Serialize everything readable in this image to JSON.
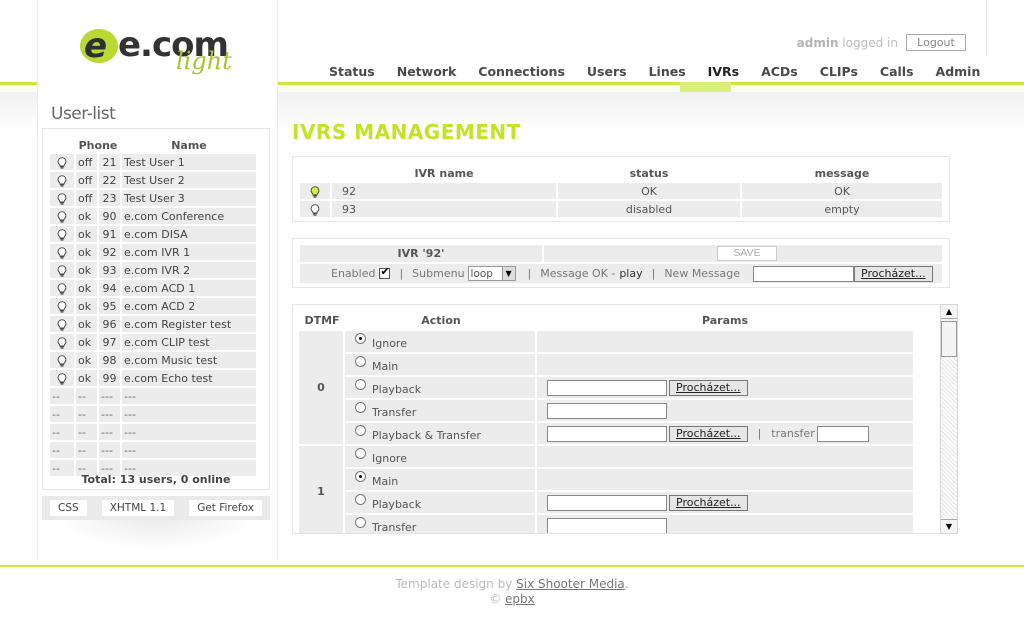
{
  "brand": {
    "logo_main": "e.com",
    "logo_sub": "light"
  },
  "header": {
    "login_user": "admin",
    "login_text": "logged in",
    "logout_label": "Logout"
  },
  "nav": {
    "active": "IVRs",
    "items": [
      "Status",
      "Network",
      "Connections",
      "Users",
      "Lines",
      "IVRs",
      "ACDs",
      "CLIPs",
      "Calls",
      "Admin"
    ]
  },
  "userlist": {
    "title": "User-list",
    "col_phone": "Phone",
    "col_name": "Name",
    "rows": [
      {
        "status": "off",
        "number": "21",
        "name": "Test User 1"
      },
      {
        "status": "off",
        "number": "22",
        "name": "Test User 2"
      },
      {
        "status": "off",
        "number": "23",
        "name": "Test User 3"
      },
      {
        "status": "ok",
        "number": "90",
        "name": "e.com Conference"
      },
      {
        "status": "ok",
        "number": "91",
        "name": "e.com DISA"
      },
      {
        "status": "ok",
        "number": "92",
        "name": "e.com IVR 1"
      },
      {
        "status": "ok",
        "number": "93",
        "name": "e.com IVR 2"
      },
      {
        "status": "ok",
        "number": "94",
        "name": "e.com ACD 1"
      },
      {
        "status": "ok",
        "number": "95",
        "name": "e.com ACD 2"
      },
      {
        "status": "ok",
        "number": "96",
        "name": "e.com Register test"
      },
      {
        "status": "ok",
        "number": "97",
        "name": "e.com CLIP test"
      },
      {
        "status": "ok",
        "number": "98",
        "name": "e.com Music test"
      },
      {
        "status": "ok",
        "number": "99",
        "name": "e.com Echo test"
      }
    ],
    "empty_cells": [
      "--",
      "--",
      "---",
      "---"
    ],
    "empty_count": 5,
    "total": "Total: 13 users, 0 online",
    "badges": [
      "CSS",
      "XHTML 1.1",
      "Get Firefox"
    ]
  },
  "page_title": "IVRS MANAGEMENT",
  "ivr_list": {
    "col_name": "IVR name",
    "col_status": "status",
    "col_message": "message",
    "rows": [
      {
        "name": "92",
        "status": "OK",
        "message": "OK",
        "lit": true
      },
      {
        "name": "93",
        "status": "disabled",
        "message": "empty",
        "lit": false
      }
    ]
  },
  "ivr_edit": {
    "title": "IVR '92'",
    "save_label": "SAVE",
    "enabled_label": "Enabled",
    "enabled_checked": true,
    "submenu_label": "Submenu",
    "submenu_value": "loop",
    "message_label": "Message OK -",
    "play_label": "play",
    "new_message_label": "New Message",
    "browse_label": "Procházet..."
  },
  "dtmf": {
    "col_dtmf": "DTMF",
    "col_action": "Action",
    "col_params": "Params",
    "browse_label": "Procházet...",
    "transfer_label": "transfer",
    "groups": [
      {
        "digit": "0",
        "rows": [
          {
            "action": "Ignore",
            "selected": true,
            "params": "none"
          },
          {
            "action": "Main",
            "selected": false,
            "params": "none"
          },
          {
            "action": "Playback",
            "selected": false,
            "params": "file"
          },
          {
            "action": "Transfer",
            "selected": false,
            "params": "text"
          },
          {
            "action": "Playback & Transfer",
            "selected": false,
            "params": "file-transfer"
          }
        ]
      },
      {
        "digit": "1",
        "rows": [
          {
            "action": "Ignore",
            "selected": false,
            "params": "none"
          },
          {
            "action": "Main",
            "selected": true,
            "params": "none"
          },
          {
            "action": "Playback",
            "selected": false,
            "params": "file"
          },
          {
            "action": "Transfer",
            "selected": false,
            "params": "text"
          }
        ]
      }
    ]
  },
  "footer": {
    "line1_prefix": "Template design by",
    "line1_link": "Six Shooter Media",
    "line1_suffix": ".",
    "line2_prefix": "©",
    "line2_link": "epbx"
  },
  "colors": {
    "accent": "#c4e227",
    "rule": "#c8e63c",
    "off": "#e00000"
  }
}
